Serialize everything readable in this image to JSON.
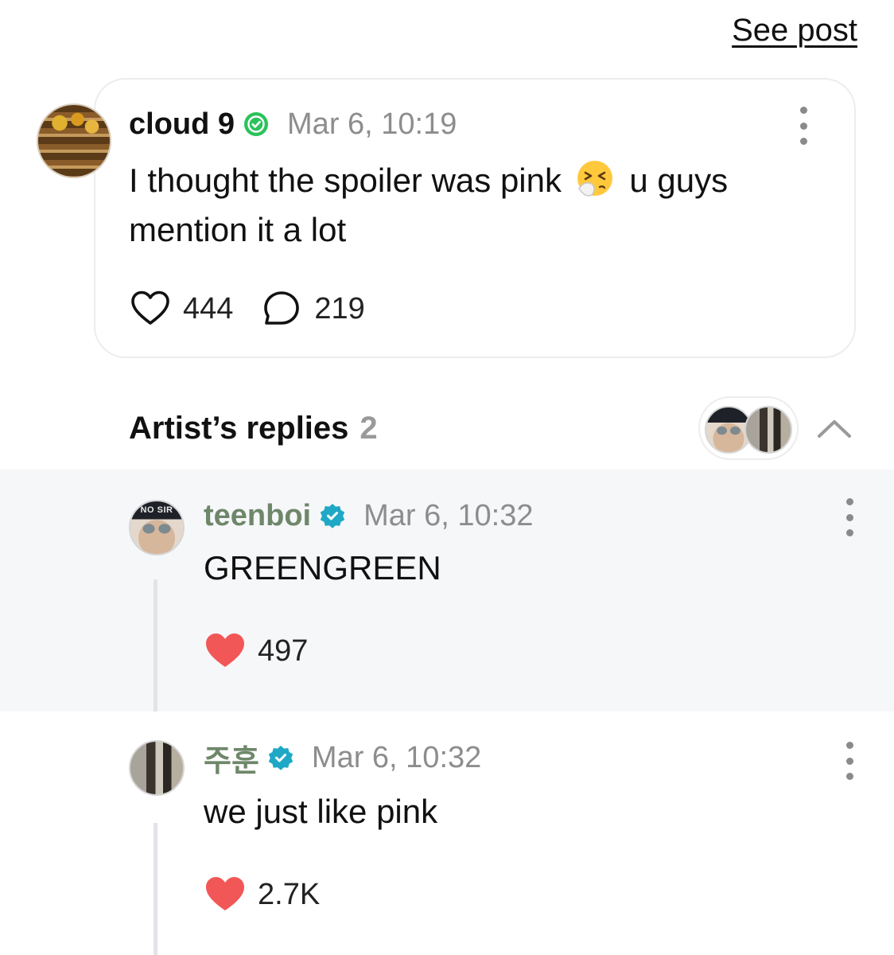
{
  "header": {
    "see_post": "See post"
  },
  "post": {
    "username": "cloud 9",
    "time": "Mar 6, 10:19",
    "text_before_emoji": "I thought the spoiler was pink",
    "emoji": "sneezing-face-emoji",
    "text_after_emoji": "u guys mention it a lot",
    "likes": "444",
    "comments": "219"
  },
  "artist_replies": {
    "title": "Artist’s replies",
    "count": "2",
    "replies": [
      {
        "username": "teenboi",
        "time": "Mar 6, 10:32",
        "avatar_cap_text": "NO SIR",
        "text": "GREENGREEN",
        "likes": "497"
      },
      {
        "username": "주훈",
        "time": "Mar 6, 10:32",
        "text": "we just like pink",
        "likes": "2.7K"
      }
    ]
  },
  "colors": {
    "verified_post": "#2bc25b",
    "verified_artist": "#1fa8c6",
    "heart_liked": "#f25757",
    "artist_name": "#6e8769",
    "muted_text": "#8d8d8d",
    "highlight_bg": "#f6f7f9"
  },
  "icons": {
    "like": "heart-outline-icon",
    "comment": "speech-bubble-icon",
    "liked": "heart-filled-icon",
    "more": "more-vertical-icon",
    "collapse": "chevron-up-icon",
    "verified": "verified-badge-icon"
  }
}
